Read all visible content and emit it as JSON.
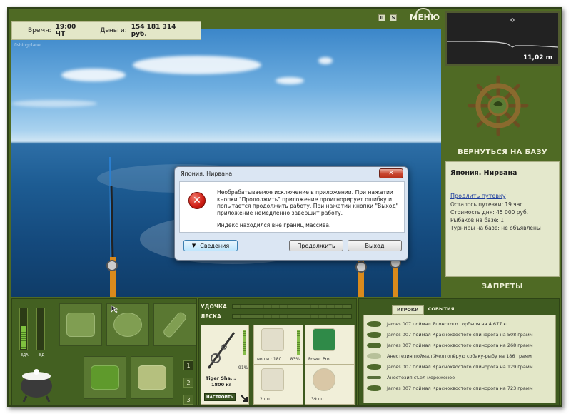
{
  "top_bar": {
    "time_label": "Время:",
    "time_value": "19:00 ЧТ",
    "money_label": "Деньги:",
    "money_value": "154 181 314 руб.",
    "watermark": "fishingplanet",
    "pause_label": "II",
    "sound_label": "S",
    "menu_label": "МЕНЮ"
  },
  "depth": {
    "value": "11,02 m"
  },
  "right_panel": {
    "return_label": "ВЕРНУТЬСЯ НА БАЗУ",
    "lake_title": "Япония. Нирвана",
    "extend_link": "Продлить путевку",
    "lines": [
      "Осталось путевки: 19 час.",
      "Стоимость дня: 45 000 руб.",
      "Рыбаков на базе: 1",
      "Турниры на базе: не объявлены"
    ],
    "bans_label": "ЗАПРЕТЫ"
  },
  "meters": {
    "food_label": "ЕДА",
    "food_level": 0.55,
    "drink_label": "ВД",
    "drink_level": 0.0
  },
  "pages": [
    "1",
    "2",
    "3"
  ],
  "tackle": {
    "rod_bar_label": "УДОЧКА",
    "line_bar_label": "ЛЕСКА",
    "rod_name": "Tiger Sha...",
    "rod_weight": "1800 кг",
    "rod_percent": "91%",
    "configure_label": "НАСТРОИТЬ",
    "slots": [
      {
        "caption": "ношн.: 180",
        "extra": "83%"
      },
      {
        "caption": "Power Pro..."
      },
      {
        "caption": "2 шт."
      },
      {
        "caption": "39 шт."
      }
    ]
  },
  "events": {
    "tabs": [
      "ИГРОКИ",
      "СОБЫТИЯ"
    ],
    "items": [
      "James 007 поймал Японского горбыля на 4,677 кг",
      "James 007 поймал Краснохвостого спинорога на 508 грамм",
      "James 007 поймал Краснохвостого спинорога на 268 грамм",
      "Анестезия поймал Желтопёрую собаку-рыбу на 186 грамм",
      "James 007 поймал Краснохвостого спинорога на 129 грамм",
      "Анестезия съел мороженое",
      "James 007 поймал Краснохвостого спинорога на 723 грамм"
    ]
  },
  "dialog": {
    "title": "Япония: Нирвана",
    "close_label": "✕",
    "message": "Необрабатываемое исключение в приложении. При нажатии кнопки \"Продолжить\" приложение проигнорирует ошибку и попытается продолжить работу. При нажатии кнопки \"Выход\" приложение немедленно завершит работу.",
    "detail": "Индекс находился вне границ массива.",
    "details_button": "Сведения",
    "continue_button": "Продолжить",
    "exit_button": "Выход"
  }
}
